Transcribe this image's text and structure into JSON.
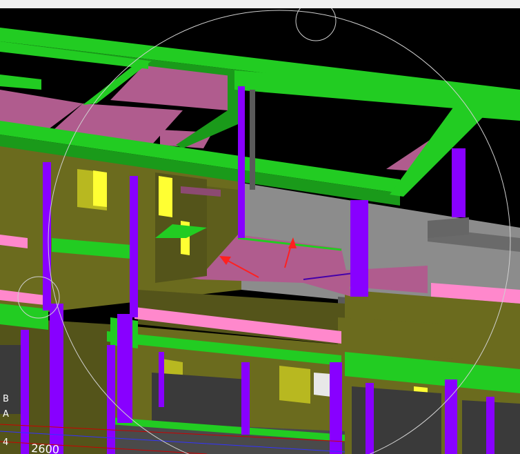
{
  "colors": {
    "beam": "#22cc22",
    "beam_dark": "#1a9a1a",
    "slab": "#b05c8e",
    "slab_light": "#ff88cc",
    "wall": "#6b6b1e",
    "wall_dark": "#54541a",
    "column": "#8800ff",
    "window": "#ffff33",
    "window_dark": "#b8b820",
    "grey_wall": "#8c8c8c",
    "grey_dark": "#555555",
    "floor_dark": "#3a3a3a",
    "background": "#000000",
    "orbit": "#d0d0d0",
    "arrow": "#ff2020",
    "axis_line": "#cc0000"
  },
  "axis_labels": [
    "B",
    "A",
    "4"
  ],
  "dimension_label": "2600",
  "icons": [
    "orbit-ring-icon",
    "orbit-handle-top-icon",
    "orbit-handle-left-icon",
    "direction-arrow-icon"
  ]
}
